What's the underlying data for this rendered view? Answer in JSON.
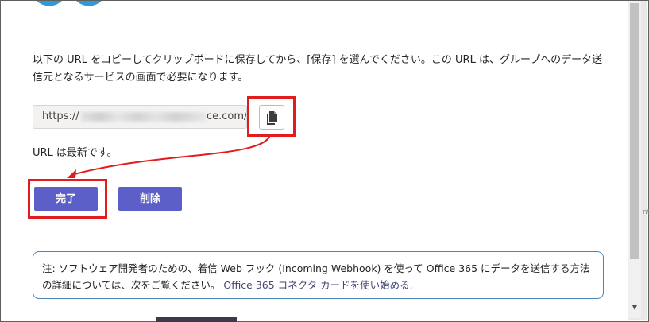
{
  "dialog": {
    "instructions": "以下の URL をコピーしてクリップボードに保存してから、[保存] を選んでください。この URL は、グループへのデータ送信元となるサービスの画面で必要になります。",
    "url_field": {
      "visible_prefix": "https://",
      "visible_suffix": "ce.com/we"
    },
    "copy_button_icon": "copy-icon",
    "status_text": "URL は最新です。",
    "done_label": "完了",
    "delete_label": "削除",
    "note": {
      "text": "注: ソフトウェア開発者のための、着信 Web フック (Incoming Webhook) を使って Office 365 にデータを送信する方法の詳細については、次をご覧ください。",
      "link_text": "Office 365 コネクタ カードを使い始める."
    }
  },
  "side_fragment": "nt",
  "colors": {
    "primary_button": "#5b5fc7",
    "annotation": "#e21c1c",
    "note_border": "#4a86b8",
    "logo": "#2f9bd6"
  }
}
